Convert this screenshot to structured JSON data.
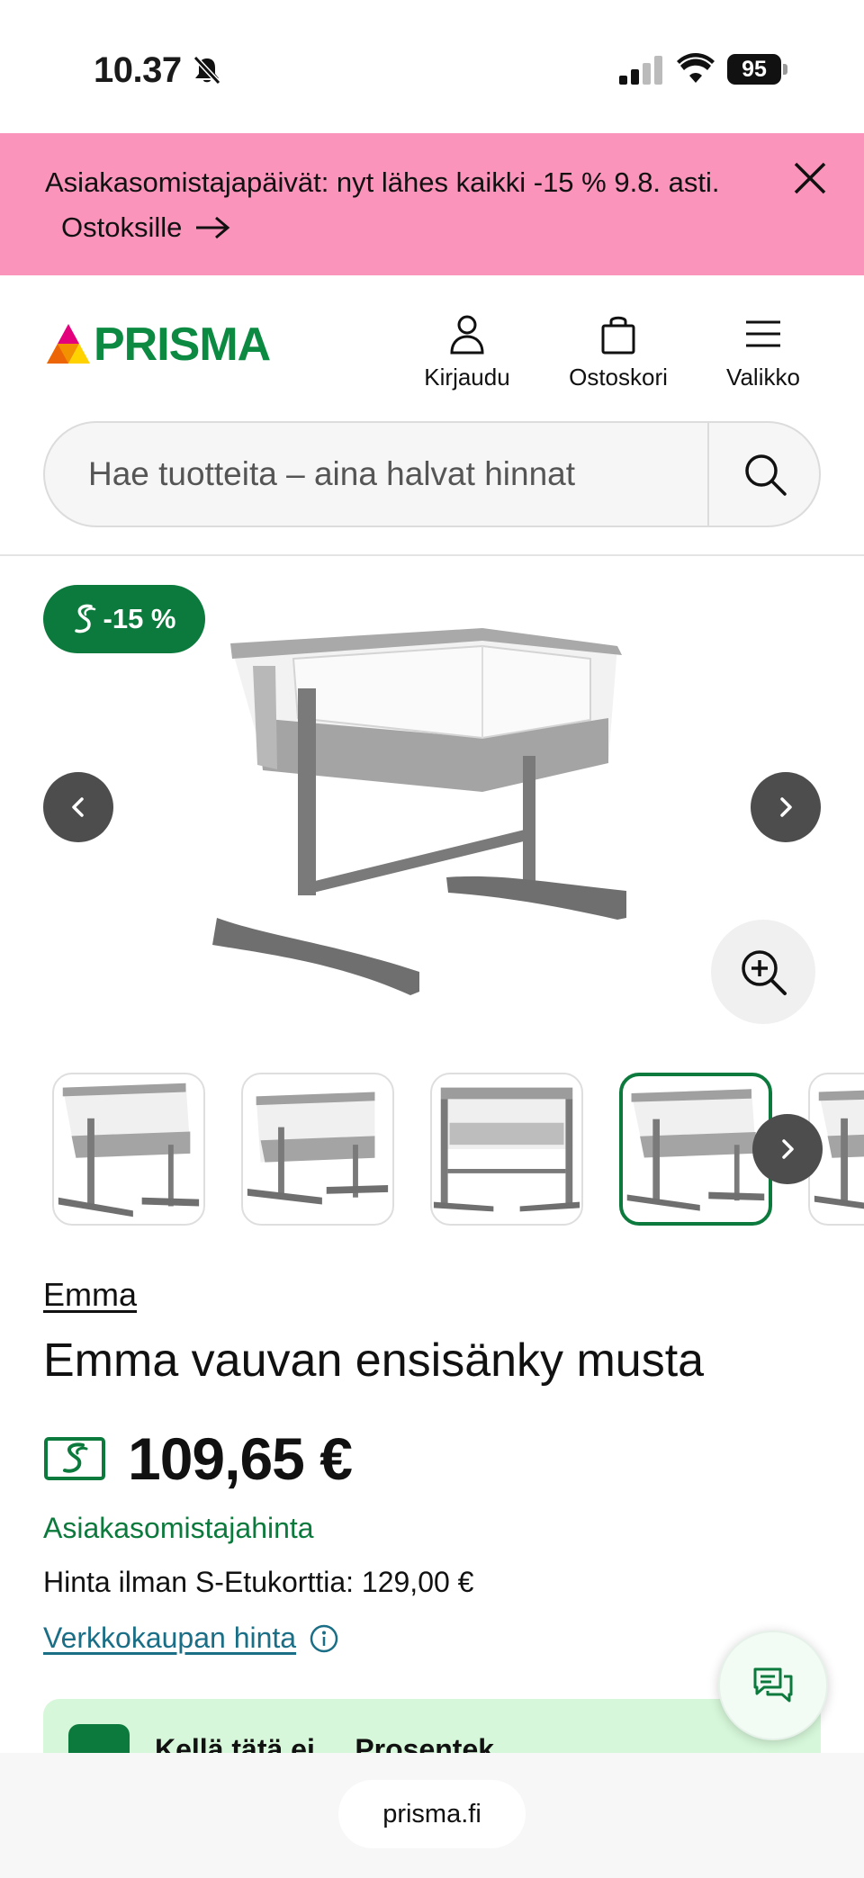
{
  "status_bar": {
    "time": "10.37",
    "battery": "95"
  },
  "promo_banner": {
    "text": "Asiakasomistajapäivät: nyt lähes kaikki -15 % 9.8. asti.",
    "link_label": "Ostoksille"
  },
  "header": {
    "logo_text": "PRISMA",
    "login_label": "Kirjaudu",
    "cart_label": "Ostoskori",
    "menu_label": "Valikko"
  },
  "search": {
    "placeholder": "Hae tuotteita – aina halvat hinnat"
  },
  "product": {
    "discount_badge": "-15 %",
    "brand": "Emma",
    "title": "Emma vauvan ensisänky musta",
    "price": "109,65 €",
    "member_price_label": "Asiakasomistajahinta",
    "regular_price": "Hinta ilman S-Etukorttia: 129,00 €",
    "online_price_label": "Verkkokaupan hinta"
  },
  "promo_card": {
    "text": "Kellä tätä ei ... Prosentek"
  },
  "browser": {
    "url": "prisma.fi"
  },
  "colors": {
    "brand_green": "#0d7a3d",
    "promo_pink": "#fb94ba",
    "link_teal": "#1a6e86",
    "promo_card_bg": "#d6f7d9"
  }
}
